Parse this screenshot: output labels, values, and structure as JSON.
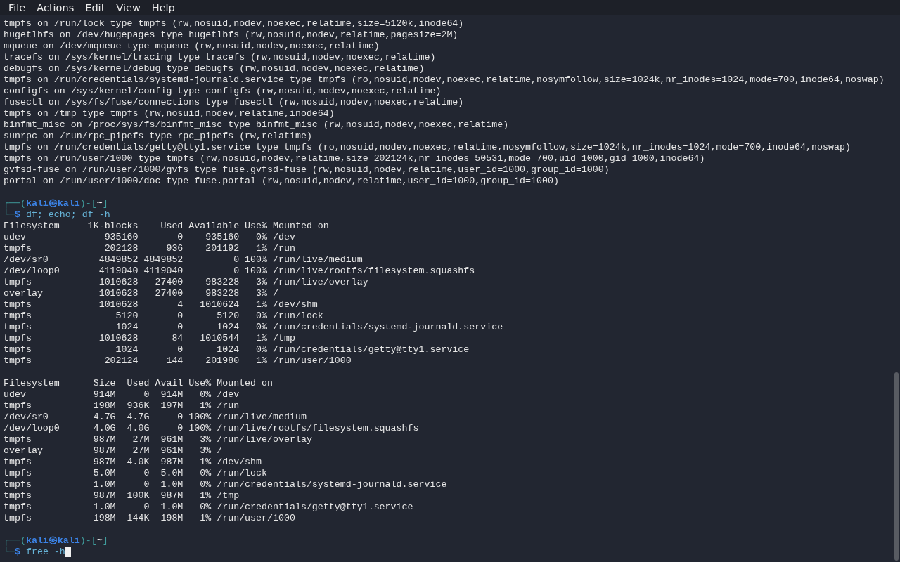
{
  "menu": [
    "File",
    "Actions",
    "Edit",
    "View",
    "Help"
  ],
  "blocks": [
    {
      "kind": "output",
      "lines": [
        "tmpfs on /run/lock type tmpfs (rw,nosuid,nodev,noexec,relatime,size=5120k,inode64)",
        "hugetlbfs on /dev/hugepages type hugetlbfs (rw,nosuid,nodev,relatime,pagesize=2M)",
        "mqueue on /dev/mqueue type mqueue (rw,nosuid,nodev,noexec,relatime)",
        "tracefs on /sys/kernel/tracing type tracefs (rw,nosuid,nodev,noexec,relatime)",
        "debugfs on /sys/kernel/debug type debugfs (rw,nosuid,nodev,noexec,relatime)",
        "tmpfs on /run/credentials/systemd-journald.service type tmpfs (ro,nosuid,nodev,noexec,relatime,nosymfollow,size=1024k,nr_inodes=1024,mode=700,inode64,noswap)",
        "configfs on /sys/kernel/config type configfs (rw,nosuid,nodev,noexec,relatime)",
        "fusectl on /sys/fs/fuse/connections type fusectl (rw,nosuid,nodev,noexec,relatime)",
        "tmpfs on /tmp type tmpfs (rw,nosuid,nodev,relatime,inode64)",
        "binfmt_misc on /proc/sys/fs/binfmt_misc type binfmt_misc (rw,nosuid,nodev,noexec,relatime)",
        "sunrpc on /run/rpc_pipefs type rpc_pipefs (rw,relatime)",
        "tmpfs on /run/credentials/getty@tty1.service type tmpfs (ro,nosuid,nodev,noexec,relatime,nosymfollow,size=1024k,nr_inodes=1024,mode=700,inode64,noswap)",
        "tmpfs on /run/user/1000 type tmpfs (rw,nosuid,nodev,relatime,size=202124k,nr_inodes=50531,mode=700,uid=1000,gid=1000,inode64)",
        "gvfsd-fuse on /run/user/1000/gvfs type fuse.gvfsd-fuse (rw,nosuid,nodev,relatime,user_id=1000,group_id=1000)",
        "portal on /run/user/1000/doc type fuse.portal (rw,nosuid,nodev,relatime,user_id=1000,group_id=1000)"
      ]
    },
    {
      "kind": "blank"
    },
    {
      "kind": "prompt",
      "open": "┌──(",
      "user": "kali㉿kali",
      "close": ")-[",
      "cwd": "~",
      "end": "]",
      "corner": "└─",
      "sign": "$",
      "command": "df; echo; df -h",
      "cursor": false
    },
    {
      "kind": "output",
      "lines": [
        "Filesystem     1K-blocks    Used Available Use% Mounted on",
        "udev              935160       0    935160   0% /dev",
        "tmpfs             202128     936    201192   1% /run",
        "/dev/sr0         4849852 4849852         0 100% /run/live/medium",
        "/dev/loop0       4119040 4119040         0 100% /run/live/rootfs/filesystem.squashfs",
        "tmpfs            1010628   27400    983228   3% /run/live/overlay",
        "overlay          1010628   27400    983228   3% /",
        "tmpfs            1010628       4   1010624   1% /dev/shm",
        "tmpfs               5120       0      5120   0% /run/lock",
        "tmpfs               1024       0      1024   0% /run/credentials/systemd-journald.service",
        "tmpfs            1010628      84   1010544   1% /tmp",
        "tmpfs               1024       0      1024   0% /run/credentials/getty@tty1.service",
        "tmpfs             202124     144    201980   1% /run/user/1000"
      ]
    },
    {
      "kind": "blank"
    },
    {
      "kind": "output",
      "lines": [
        "Filesystem      Size  Used Avail Use% Mounted on",
        "udev            914M     0  914M   0% /dev",
        "tmpfs           198M  936K  197M   1% /run",
        "/dev/sr0        4.7G  4.7G     0 100% /run/live/medium",
        "/dev/loop0      4.0G  4.0G     0 100% /run/live/rootfs/filesystem.squashfs",
        "tmpfs           987M   27M  961M   3% /run/live/overlay",
        "overlay         987M   27M  961M   3% /",
        "tmpfs           987M  4.0K  987M   1% /dev/shm",
        "tmpfs           5.0M     0  5.0M   0% /run/lock",
        "tmpfs           1.0M     0  1.0M   0% /run/credentials/systemd-journald.service",
        "tmpfs           987M  100K  987M   1% /tmp",
        "tmpfs           1.0M     0  1.0M   0% /run/credentials/getty@tty1.service",
        "tmpfs           198M  144K  198M   1% /run/user/1000"
      ]
    },
    {
      "kind": "blank"
    },
    {
      "kind": "prompt",
      "open": "┌──(",
      "user": "kali㉿kali",
      "close": ")-[",
      "cwd": "~",
      "end": "]",
      "corner": "└─",
      "sign": "$",
      "command": "free -h",
      "cursor": true
    }
  ]
}
